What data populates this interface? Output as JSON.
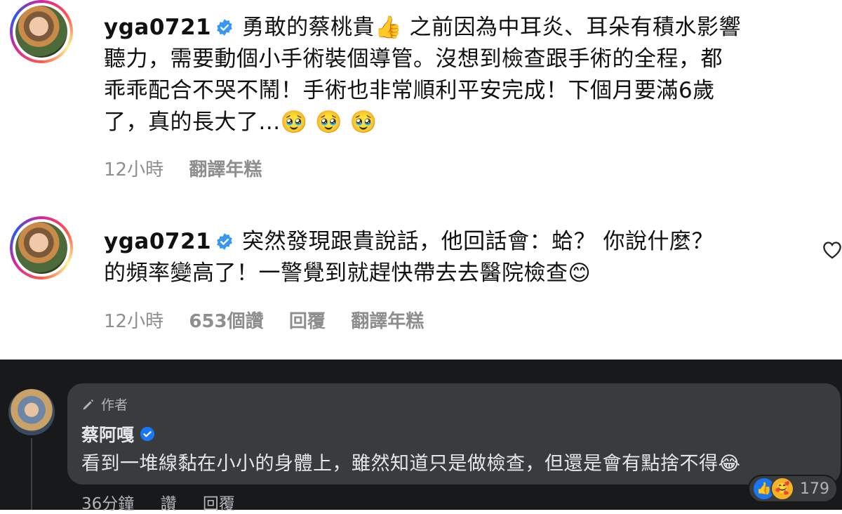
{
  "comments": [
    {
      "username": "yga0721",
      "lines": [
        "勇敢的蔡桃貴👍 之前因為中耳炎、耳朵有積水影響",
        "聽力，需要動個小手術裝個導管。沒想到檢查跟手術的全程，都",
        "乖乖配合不哭不鬧！手術也非常順利平安完成！下個月要滿6歲",
        "了，真的長大了...🥹 🥹 🥹"
      ],
      "time": "12小時",
      "translate": "翻譯年糕"
    },
    {
      "username": "yga0721",
      "lines": [
        "突然發現跟貴說話，他回話會：蛤？ 你說什麼？",
        "的頻率變高了！一警覺到就趕快帶去去醫院檢查😊"
      ],
      "time": "12小時",
      "likes": "653個讚",
      "reply": "回覆",
      "translate": "翻譯年糕"
    }
  ],
  "fb_comment": {
    "author_tag": "作者",
    "name": "蔡阿嘎",
    "text": "看到一堆線黏在小小的身體上，雖然知道只是做檢查，但還是會有點捨不得😂",
    "time": "36分鐘",
    "like": "讚",
    "reply": "回覆",
    "reaction_count": "179"
  },
  "colors": {
    "verified": "#3897f0",
    "fb_verified": "#1877f2",
    "ig_meta": "#8e8e8e",
    "fb_bg": "#18191a",
    "fb_bubble": "#3a3b3c"
  }
}
